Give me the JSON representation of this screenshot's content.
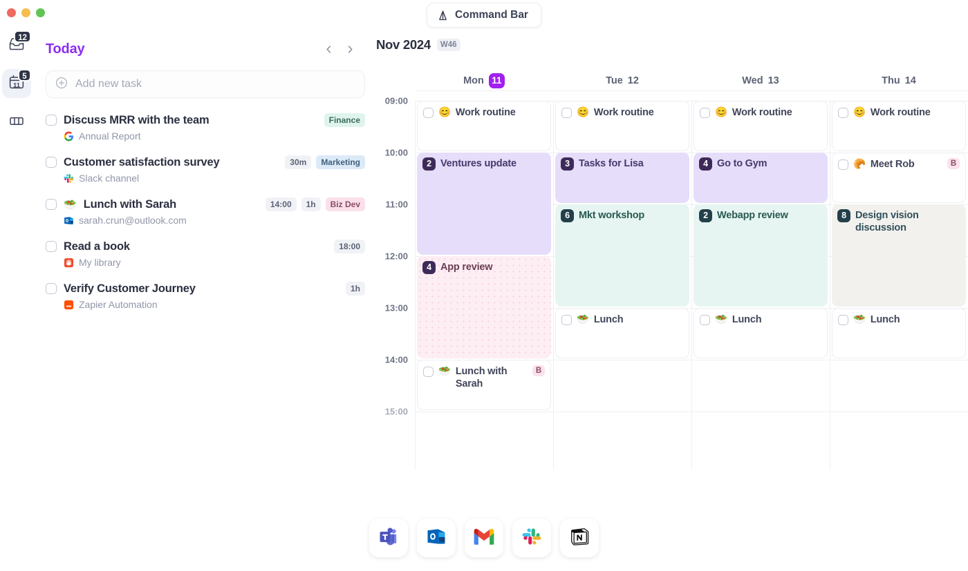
{
  "window": {
    "traffic_lights": [
      "close",
      "minimize",
      "maximize"
    ]
  },
  "command_bar": {
    "label": "Command Bar",
    "icon": "arch-icon"
  },
  "rail": {
    "items": [
      {
        "name": "inbox",
        "icon": "inbox-icon",
        "badge": "12",
        "active": false
      },
      {
        "name": "calendar",
        "icon": "calendar-icon",
        "badge": "5",
        "day_number": "11",
        "active": true
      },
      {
        "name": "board",
        "icon": "columns-icon",
        "badge": "",
        "active": false
      }
    ]
  },
  "tasks_panel": {
    "title": "Today",
    "prev_label": "‹",
    "next_label": "›",
    "add_task_placeholder": "Add new task",
    "add_icon": "plus-circle-icon",
    "items": [
      {
        "title": "Discuss MRR with the team",
        "emoji": "",
        "source_icon": "google-icon",
        "source": "Annual Report",
        "time": "",
        "duration": "",
        "tag": "Finance",
        "tag_class": "finance"
      },
      {
        "title": "Customer satisfaction survey",
        "emoji": "",
        "source_icon": "slack-icon",
        "source": "Slack channel",
        "time": "",
        "duration": "30m",
        "tag": "Marketing",
        "tag_class": "marketing"
      },
      {
        "title": "Lunch with Sarah",
        "emoji": "🥗",
        "source_icon": "outlook-icon",
        "source": "sarah.crun@outlook.com",
        "time": "14:00",
        "duration": "1h",
        "tag": "Biz Dev",
        "tag_class": "bizdev"
      },
      {
        "title": "Read a book",
        "emoji": "",
        "source_icon": "books-icon",
        "source": "My library",
        "time": "18:00",
        "duration": "",
        "tag": "",
        "tag_class": ""
      },
      {
        "title": "Verify Customer Journey",
        "emoji": "",
        "source_icon": "zapier-icon",
        "source": "Zapier Automation",
        "time": "",
        "duration": "1h",
        "tag": "",
        "tag_class": ""
      }
    ]
  },
  "calendar": {
    "month": "Nov 2024",
    "week": "W46",
    "days": [
      {
        "weekday": "Mon",
        "number": "11",
        "is_today": true
      },
      {
        "weekday": "Tue",
        "number": "12",
        "is_today": false
      },
      {
        "weekday": "Wed",
        "number": "13",
        "is_today": false
      },
      {
        "weekday": "Thu",
        "number": "14",
        "is_today": false
      }
    ],
    "hours": [
      "09:00",
      "10:00",
      "11:00",
      "12:00",
      "13:00",
      "14:00",
      "15:00"
    ],
    "events": [
      {
        "day": 0,
        "start": "09:00",
        "end": "10:00",
        "title": "Work routine",
        "emoji": "😊",
        "kind": "task",
        "badge": "",
        "b_flag": false
      },
      {
        "day": 0,
        "start": "10:00",
        "end": "12:00",
        "title": "Ventures update",
        "emoji": "",
        "kind": "purple",
        "badge": "2",
        "b_flag": false
      },
      {
        "day": 0,
        "start": "12:00",
        "end": "14:00",
        "title": "App review",
        "emoji": "",
        "kind": "pinkdot",
        "badge": "4",
        "b_flag": false
      },
      {
        "day": 0,
        "start": "14:00",
        "end": "15:00",
        "title": "Lunch with Sarah",
        "emoji": "🥗",
        "kind": "task",
        "badge": "",
        "b_flag": true
      },
      {
        "day": 1,
        "start": "09:00",
        "end": "10:00",
        "title": "Work routine",
        "emoji": "😊",
        "kind": "task",
        "badge": "",
        "b_flag": false
      },
      {
        "day": 1,
        "start": "10:00",
        "end": "11:00",
        "title": "Tasks for Lisa",
        "emoji": "",
        "kind": "purple",
        "badge": "3",
        "b_flag": false
      },
      {
        "day": 1,
        "start": "11:00",
        "end": "13:00",
        "title": "Mkt workshop",
        "emoji": "",
        "kind": "mint",
        "badge": "6",
        "b_flag": false
      },
      {
        "day": 1,
        "start": "13:00",
        "end": "14:00",
        "title": "Lunch",
        "emoji": "🥗",
        "kind": "task",
        "badge": "",
        "b_flag": false
      },
      {
        "day": 2,
        "start": "09:00",
        "end": "10:00",
        "title": "Work routine",
        "emoji": "😊",
        "kind": "task",
        "badge": "",
        "b_flag": false
      },
      {
        "day": 2,
        "start": "10:00",
        "end": "11:00",
        "title": "Go to Gym",
        "emoji": "",
        "kind": "purple",
        "badge": "4",
        "b_flag": false
      },
      {
        "day": 2,
        "start": "11:00",
        "end": "13:00",
        "title": "Webapp review",
        "emoji": "",
        "kind": "mint",
        "badge": "2",
        "b_flag": false
      },
      {
        "day": 2,
        "start": "13:00",
        "end": "14:00",
        "title": "Lunch",
        "emoji": "🥗",
        "kind": "task",
        "badge": "",
        "b_flag": false
      },
      {
        "day": 3,
        "start": "09:00",
        "end": "10:00",
        "title": "Work routine",
        "emoji": "😊",
        "kind": "task",
        "badge": "",
        "b_flag": false
      },
      {
        "day": 3,
        "start": "10:00",
        "end": "11:00",
        "title": "Meet Rob",
        "emoji": "🥐",
        "kind": "task",
        "badge": "",
        "b_flag": true
      },
      {
        "day": 3,
        "start": "11:00",
        "end": "13:00",
        "title": "Design vision discussion",
        "emoji": "",
        "kind": "beige",
        "badge": "8",
        "b_flag": false
      },
      {
        "day": 3,
        "start": "13:00",
        "end": "14:00",
        "title": "Lunch",
        "emoji": "🥗",
        "kind": "task",
        "badge": "",
        "b_flag": false
      }
    ],
    "b_flag_label": "B"
  },
  "dock": {
    "apps": [
      {
        "name": "microsoft-teams",
        "icon": "teams-icon"
      },
      {
        "name": "microsoft-outlook",
        "icon": "outlook-icon"
      },
      {
        "name": "gmail",
        "icon": "gmail-icon"
      },
      {
        "name": "slack",
        "icon": "slack-icon"
      },
      {
        "name": "notion",
        "icon": "notion-icon"
      }
    ]
  },
  "colors": {
    "accent_purple": "#8b2df0",
    "today_badge": "#a020f0",
    "event_purple": "#e5ddfa",
    "event_mint": "#e6f5f1",
    "event_pink": "#fdeef4",
    "event_beige": "#f3f1ee"
  }
}
